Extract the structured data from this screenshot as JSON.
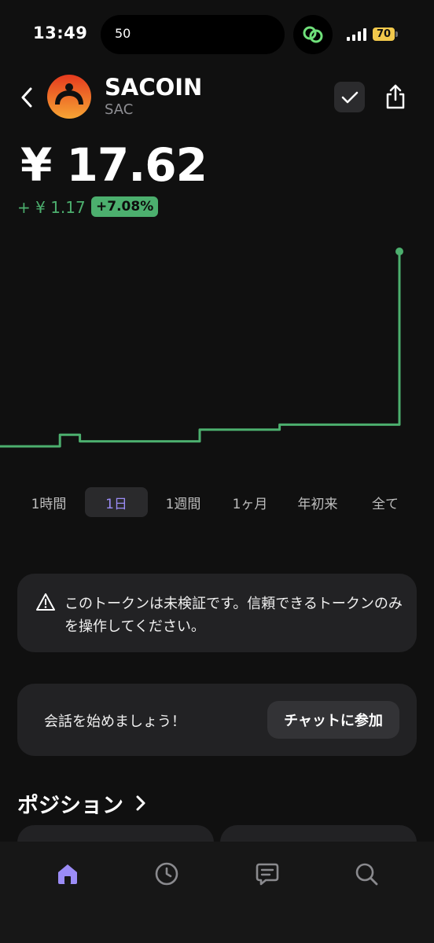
{
  "status_bar": {
    "time": "13:49",
    "island_text": "50",
    "battery": "70"
  },
  "header": {
    "token_name": "SACOIN",
    "token_symbol": "SAC",
    "icons": [
      "back-icon",
      "check-icon",
      "share-icon"
    ]
  },
  "price": {
    "value": "¥ 17.62",
    "change_abs": "+ ¥ 1.17",
    "change_pct": "+7.08%"
  },
  "colors": {
    "accent": "#9b8cf6",
    "positive": "#4caf6e",
    "background": "#101010",
    "card": "#222224"
  },
  "chart_data": {
    "type": "line",
    "values": [
      16.45,
      16.45,
      16.45,
      16.52,
      16.48,
      16.48,
      16.48,
      16.48,
      16.48,
      16.48,
      16.55,
      16.55,
      16.55,
      16.55,
      16.58,
      16.58,
      16.58,
      16.58,
      16.58,
      16.58,
      17.62
    ]
  },
  "range_tabs": [
    {
      "label": "1時間",
      "active": false
    },
    {
      "label": "1日",
      "active": true
    },
    {
      "label": "1週間",
      "active": false
    },
    {
      "label": "1ヶ月",
      "active": false
    },
    {
      "label": "年初来",
      "active": false
    },
    {
      "label": "全て",
      "active": false
    }
  ],
  "warning": {
    "text": "このトークンは未検証です。信頼できるトークンのみを操作してください。"
  },
  "chat": {
    "prompt": "会話を始めましょう！",
    "button_label": "チャットに参加"
  },
  "positions": {
    "title": "ポジション"
  },
  "tab_bar": {
    "items": [
      {
        "icon": "home-icon",
        "active": true
      },
      {
        "icon": "clock-icon",
        "active": false
      },
      {
        "icon": "chat-icon",
        "active": false
      },
      {
        "icon": "search-icon",
        "active": false
      }
    ]
  }
}
